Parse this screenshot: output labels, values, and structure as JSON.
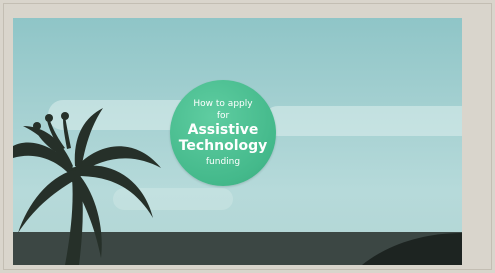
{
  "video": {
    "bubble": {
      "line1": "How to apply",
      "line2": "for",
      "line3": "Assistive",
      "line4": "Technology",
      "line5": "funding"
    }
  },
  "colors": {
    "frame": "#d9d5cc",
    "sky": "#a6d1d2",
    "bubble": "#44b98b",
    "palm": "#263029",
    "ground": "#3c4744"
  }
}
